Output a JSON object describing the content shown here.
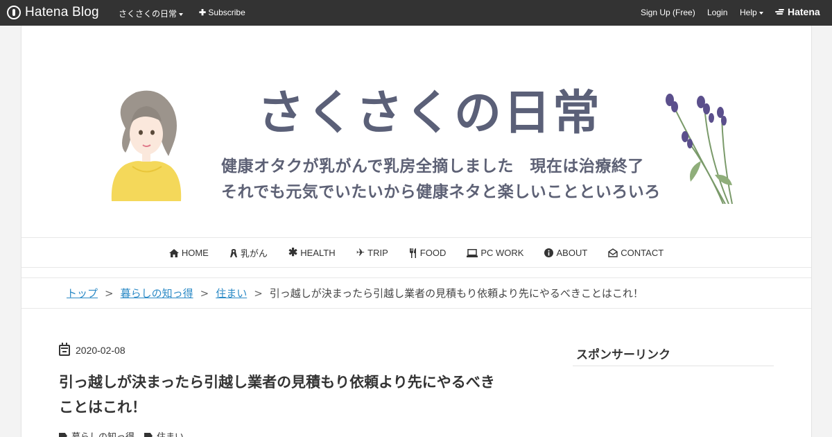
{
  "topbar": {
    "brand": "Hatena Blog",
    "blog_selector": "さくさくの日常",
    "subscribe": "Subscribe",
    "signup": "Sign Up (Free)",
    "login": "Login",
    "help": "Help",
    "hatena": "Hatena"
  },
  "banner": {
    "title": "さくさくの日常",
    "subtitle_line1": "健康オタクが乳がんで乳房全摘しました　現在は治療終了",
    "subtitle_line2": "それでも元気でいたいから健康ネタと楽しいことといろいろ"
  },
  "nav": {
    "items": [
      {
        "label": "HOME",
        "icon": "home-icon"
      },
      {
        "label": "乳がん",
        "icon": "ribbon-icon"
      },
      {
        "label": "HEALTH",
        "icon": "asterisk-icon"
      },
      {
        "label": "TRIP",
        "icon": "plane-icon"
      },
      {
        "label": "FOOD",
        "icon": "cutlery-icon"
      },
      {
        "label": "PC WORK",
        "icon": "laptop-icon"
      },
      {
        "label": "ABOUT",
        "icon": "info-icon"
      },
      {
        "label": "CONTACT",
        "icon": "envelope-icon"
      }
    ]
  },
  "breadcrumb": {
    "top": "トップ",
    "category": "暮らしの知っ得",
    "subcategory": "住まい",
    "separator": ">",
    "current": "引っ越しが決まったら引越し業者の見積もり依頼より先にやるべきことはこれ！"
  },
  "article": {
    "date": "2020-02-08",
    "title": "引っ越しが決まったら引越し業者の見積もり依頼より先にやるべきことはこれ！",
    "categories": [
      "暮らしの知っ得",
      "住まい"
    ]
  },
  "sidebar": {
    "heading": "スポンサーリンク"
  }
}
